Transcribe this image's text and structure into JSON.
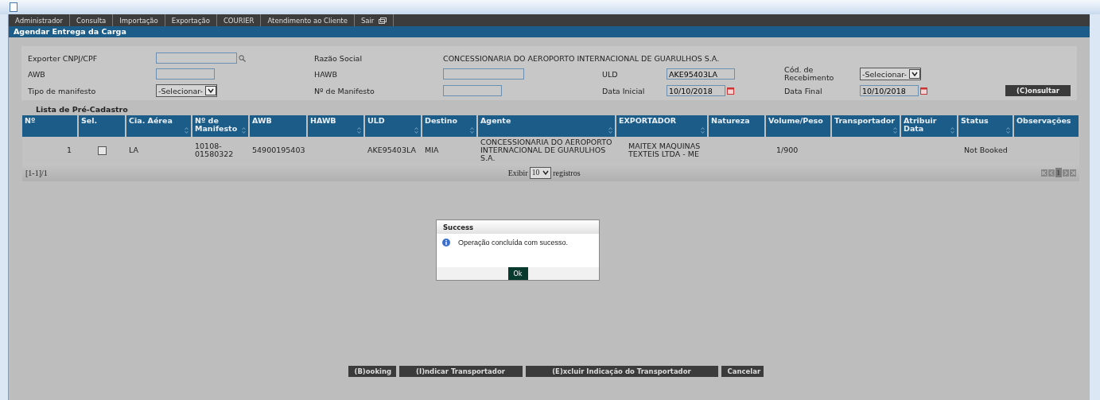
{
  "menu": [
    {
      "label": "Administrador"
    },
    {
      "label": "Consulta"
    },
    {
      "label": "Importação"
    },
    {
      "label": "Exportação"
    },
    {
      "label": "COURIER"
    },
    {
      "label": "Atendimento ao Cliente"
    },
    {
      "label": "Sair"
    }
  ],
  "page_title": "Agendar Entrega da Carga",
  "form": {
    "fields": [
      {
        "label": "Exporter CNPJ/CPF",
        "kind": "search"
      },
      {
        "label": "Razão Social",
        "kind": "text",
        "value": "CONCESSIONARIA DO AEROPORTO INTERNACIONAL DE GUARULHOS S.A."
      },
      {
        "label": "AWB",
        "kind": "input"
      },
      {
        "label": "HAWB",
        "kind": "input"
      },
      {
        "label": "ULD",
        "kind": "input",
        "value": "AKE95403LA"
      },
      {
        "label": "Cód. de Recebimento",
        "kind": "select",
        "value": "-Selecionar-"
      },
      {
        "label": "Tipo de manifesto",
        "kind": "select",
        "value": "-Selecionar-"
      },
      {
        "label": "Nº de Manifesto",
        "kind": "input"
      },
      {
        "label": "Data Inicial",
        "kind": "date",
        "value": "10/10/2018"
      },
      {
        "label": "Data Final",
        "kind": "date",
        "value": "10/10/2018"
      }
    ],
    "button": "(C)onsultar"
  },
  "list_title": "Lista de Pré-Cadastro",
  "table": {
    "columns": [
      {
        "label": "Nº",
        "sortable": false
      },
      {
        "label": "Sel.",
        "sortable": false
      },
      {
        "label": "Cia. Aérea",
        "sortable": true
      },
      {
        "label": "Nº de Manifesto",
        "sortable": true
      },
      {
        "label": "AWB",
        "sortable": false
      },
      {
        "label": "HAWB",
        "sortable": true
      },
      {
        "label": "ULD",
        "sortable": true
      },
      {
        "label": "Destino",
        "sortable": true
      },
      {
        "label": "Agente",
        "sortable": true
      },
      {
        "label": "EXPORTADOR",
        "sortable": true
      },
      {
        "label": "Natureza",
        "sortable": false
      },
      {
        "label": "Volume/Peso",
        "sortable": false
      },
      {
        "label": "Transportador",
        "sortable": true
      },
      {
        "label": "Atribuir Data",
        "sortable": true
      },
      {
        "label": "Status",
        "sortable": true
      },
      {
        "label": "Observações",
        "sortable": false
      }
    ],
    "rows": [
      {
        "number": "1",
        "checked": false,
        "airline": "LA",
        "manifest": "10108-01580322",
        "awb": "54900195403",
        "uld": "AKE95403LA",
        "destination": "MIA",
        "agent": "CONCESSIONARIA DO AEROPORTO INTERNACIONAL DE GUARULHOS S.A.",
        "exporter": "MAITEX MAQUINAS TEXTEIS LTDA - ME",
        "volume_weight": "1/900",
        "status": "Not Booked"
      }
    ]
  },
  "pager": {
    "range": "[1-1]/1",
    "show_label": "Exibir",
    "page_size": "10",
    "records_label": "registros",
    "current_page": "1"
  },
  "dialog": {
    "title": "Success",
    "message": "Operação concluída com sucesso.",
    "button": "Ok"
  },
  "actions": [
    "(B)ooking",
    "(I)ndicar Transportador",
    "(E)xcluir Indicação do Transportador",
    "Cancelar"
  ]
}
